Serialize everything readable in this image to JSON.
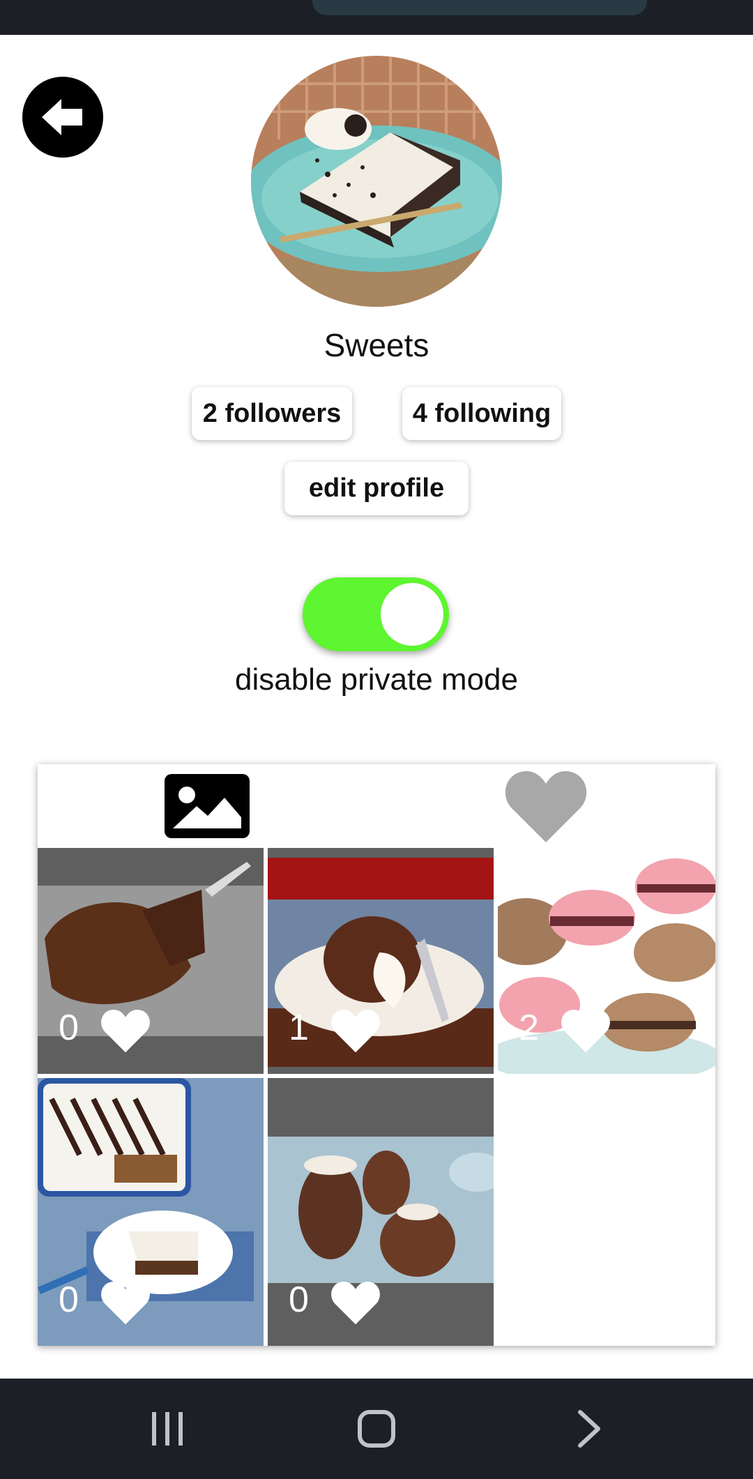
{
  "profile": {
    "name": "Sweets",
    "avatar_desc": "slice of cookies and cream pie on a teal plate"
  },
  "stats": {
    "followers_label": "2 followers",
    "following_label": "4 following"
  },
  "actions": {
    "edit_profile_label": "edit profile"
  },
  "privacy": {
    "toggle_on": true,
    "label": "disable private mode",
    "accent": "#5ef531"
  },
  "tabs": [
    {
      "name": "posts",
      "icon": "image-icon",
      "active": true
    },
    {
      "name": "liked",
      "icon": "heart-icon",
      "active": false
    }
  ],
  "posts": [
    {
      "likes": "0",
      "desc": "chocolate frosted cake"
    },
    {
      "likes": "1",
      "desc": "molten chocolate lava cake"
    },
    {
      "likes": "2",
      "desc": "pink and chocolate macarons"
    },
    {
      "likes": "0",
      "desc": "layered chocolate dessert bars"
    },
    {
      "likes": "0",
      "desc": "chocolate mousse cups"
    }
  ],
  "nav": {
    "recent_icon": "recent-apps-icon",
    "home_icon": "home-icon",
    "back_icon": "back-chevron-icon"
  }
}
